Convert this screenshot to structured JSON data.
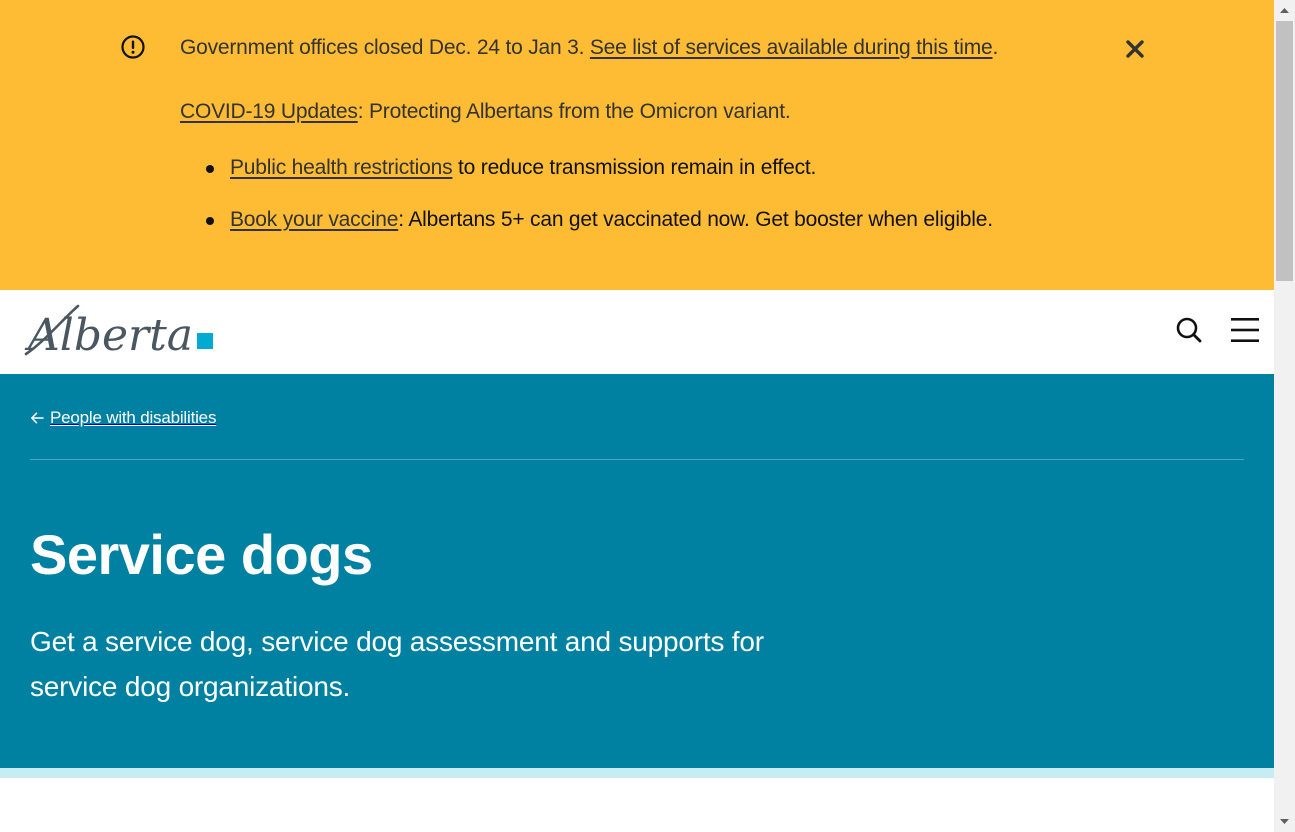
{
  "alert": {
    "line1_text": "Government offices closed Dec. 24 to Jan 3. ",
    "line1_link": "See list of services available during this time",
    "line1_end": ".",
    "line2_link": "COVID-19 Updates",
    "line2_text": ": Protecting Albertans from the Omicron variant.",
    "bullets": [
      {
        "link": "Public health restrictions",
        "text": " to reduce transmission remain in effect."
      },
      {
        "link": "Book your vaccine",
        "text": ": Albertans 5+ can get vaccinated now. Get booster when eligible."
      }
    ],
    "icon": "exclamation-circle-icon",
    "close_icon": "close-icon"
  },
  "header": {
    "logo_text": "Alberta",
    "search_icon": "search-icon",
    "menu_icon": "hamburger-menu-icon"
  },
  "hero": {
    "back_link": "People with disabilities",
    "title": "Service dogs",
    "lead": "Get a service dog, service dog assessment and supports for service dog organizations."
  },
  "colors": {
    "alert_bg": "#febc35",
    "hero_bg": "#0081a2",
    "accent_strip": "#c8ecf4",
    "logo_square": "#00aad2",
    "logo_text": "#4a5760"
  }
}
